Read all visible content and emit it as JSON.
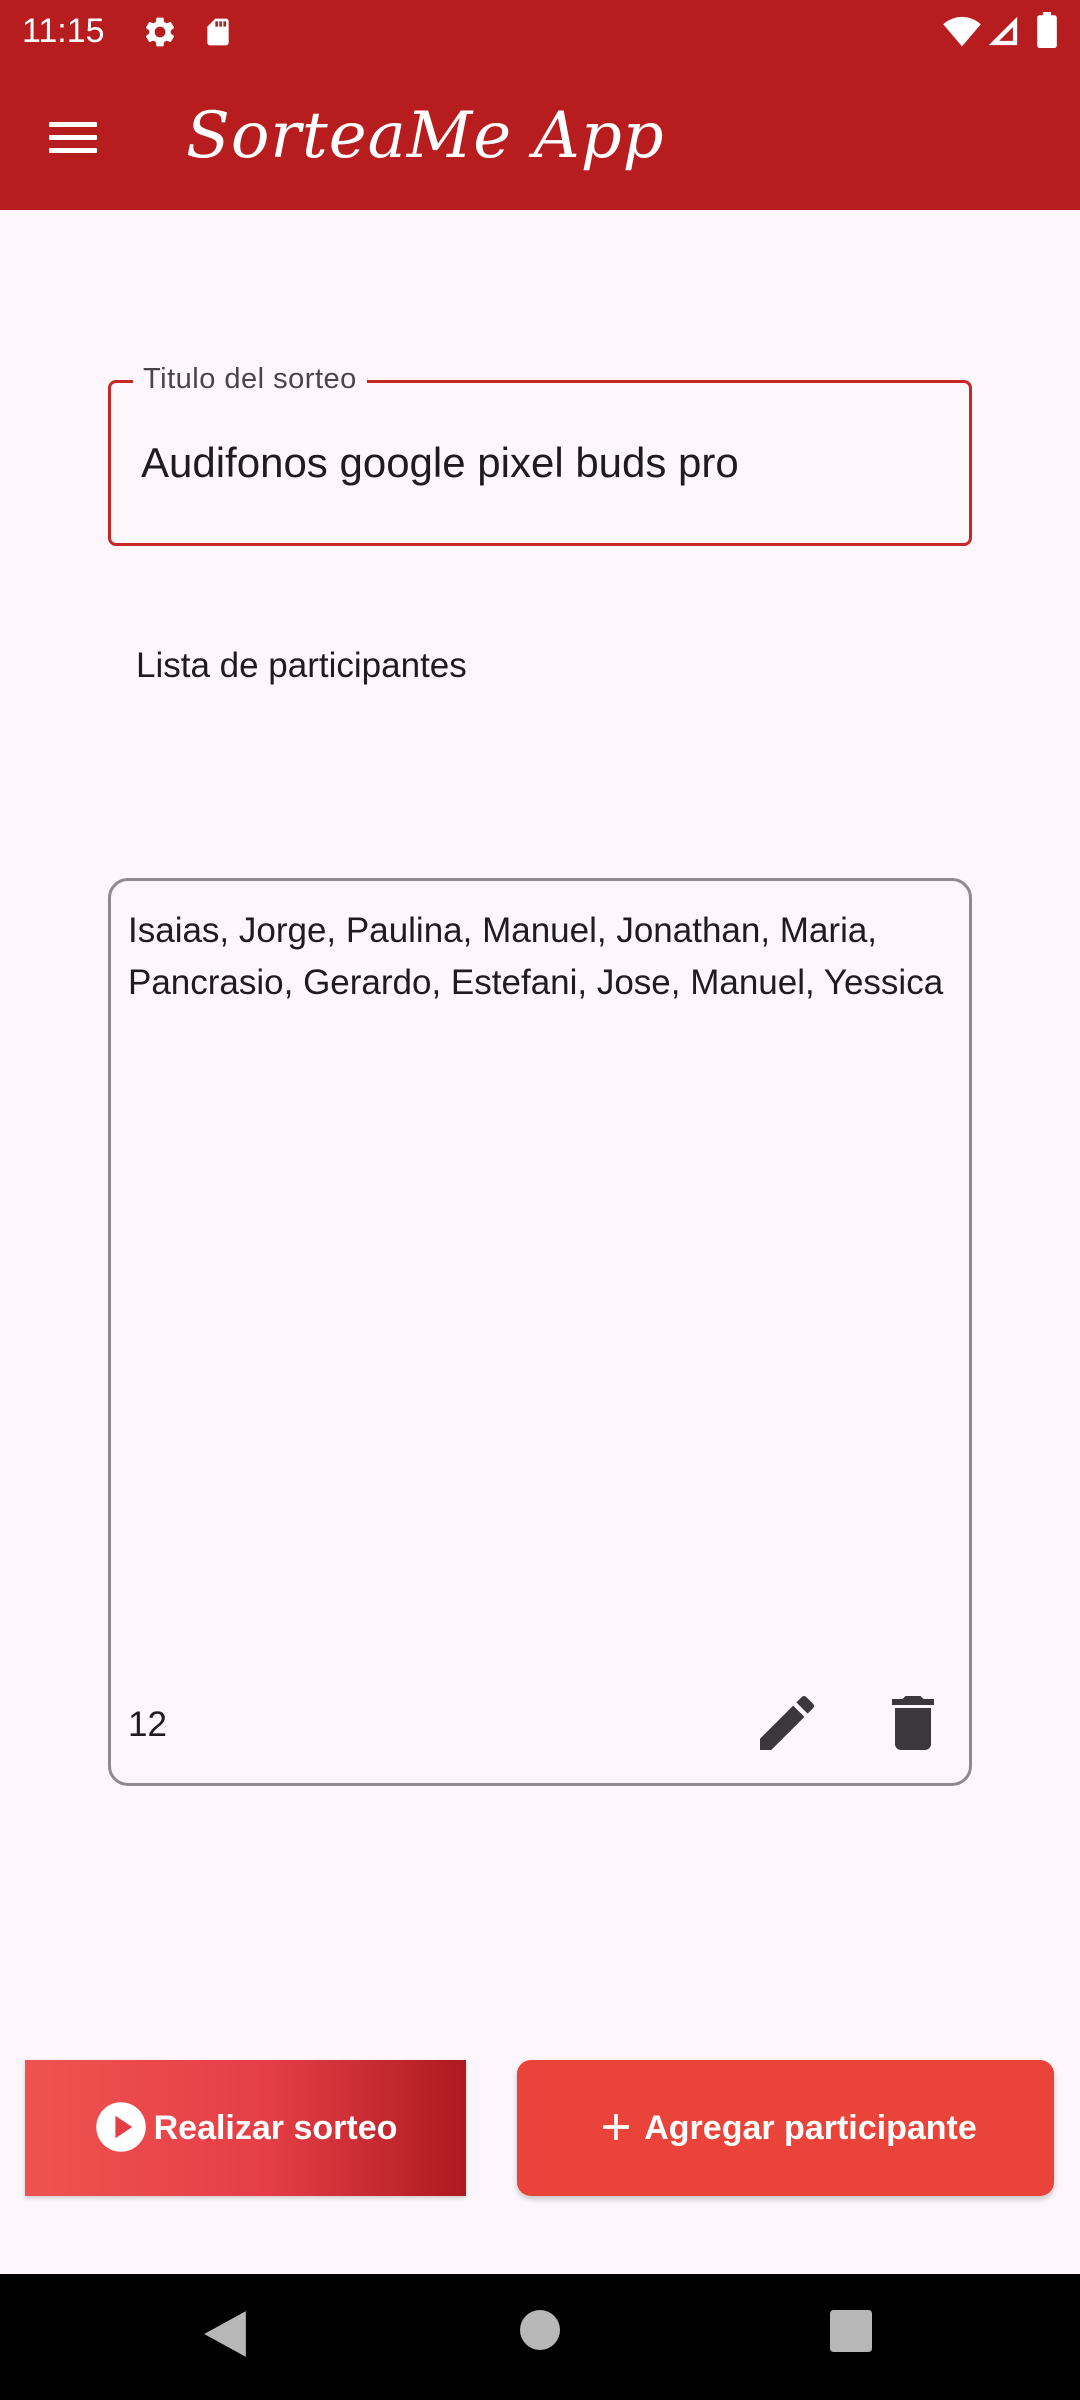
{
  "status_bar": {
    "time": "11:15",
    "icons": [
      "gear-icon",
      "sd-card-icon",
      "wifi-icon",
      "signal-icon",
      "battery-icon"
    ]
  },
  "app_bar": {
    "title": "SorteaMe App",
    "menu_icon": "menu-icon",
    "background_color": "#b71c1f"
  },
  "form": {
    "title_field": {
      "label": "Titulo del sorteo",
      "value": "Audifonos google pixel buds pro"
    },
    "participants_section": {
      "label": "Lista de participantes"
    },
    "participants_box": {
      "text": "Isaias, Jorge, Paulina, Manuel, Jonathan, Maria, Pancrasio, Gerardo, Estefani, Jose, Manuel, Yessica",
      "count": "12",
      "edit_icon": "edit-icon",
      "delete_icon": "trash-icon"
    }
  },
  "actions": {
    "draw_button": {
      "label": "Realizar sorteo",
      "icon": "play-circle-icon"
    },
    "add_button": {
      "label": "Agregar participante",
      "icon": "plus-icon"
    }
  },
  "nav_bar": {
    "icons": [
      "back-icon",
      "home-icon",
      "recents-icon"
    ]
  },
  "colors": {
    "primary": "#b71c1f",
    "accent": "#ea4339",
    "field_border": "#c62828",
    "background": "#fdf7fb"
  }
}
